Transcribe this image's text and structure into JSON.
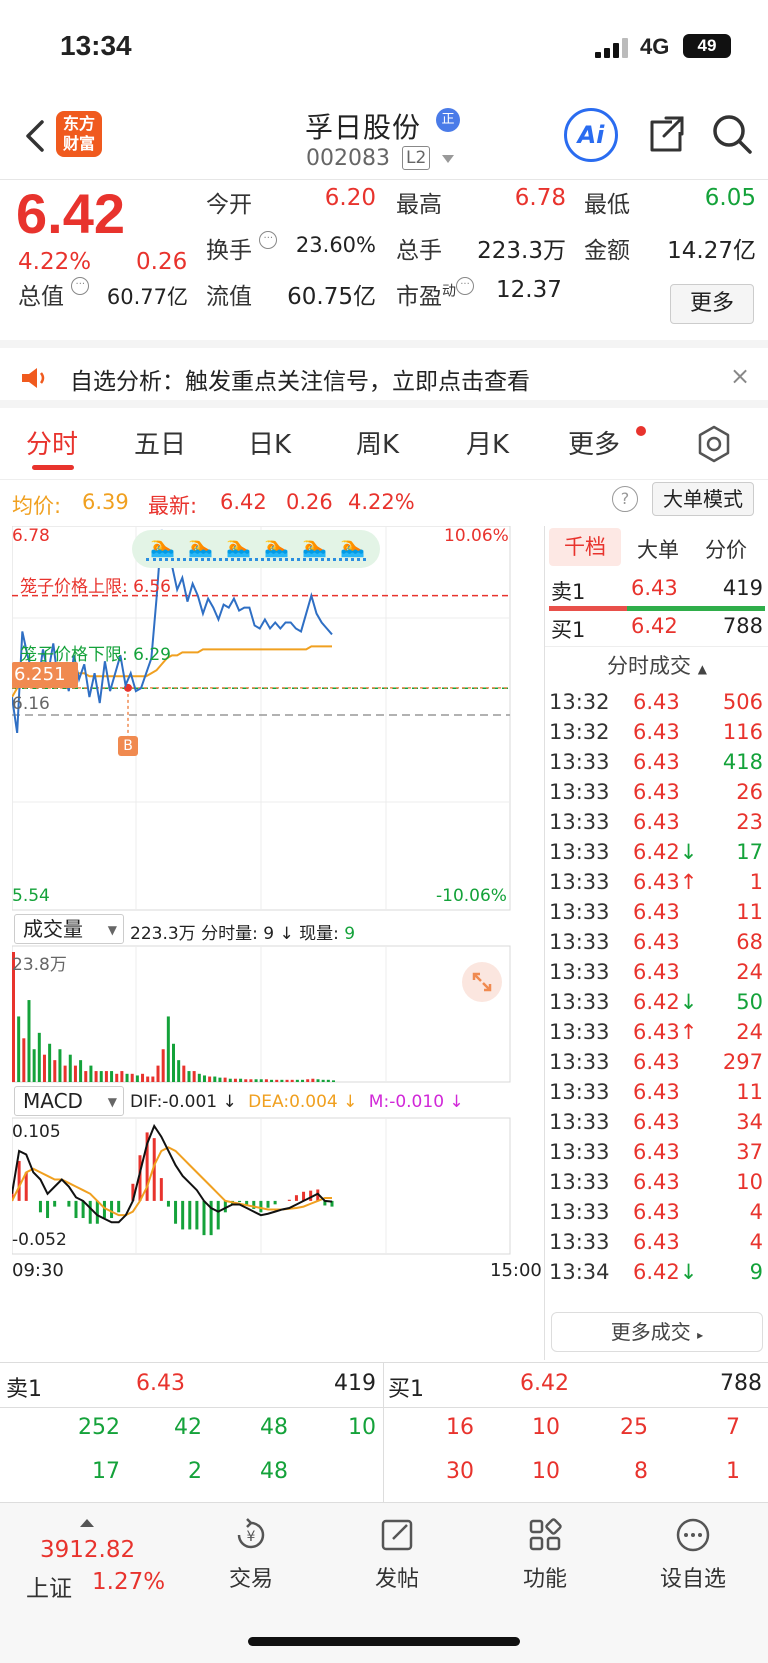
{
  "status_bar": {
    "time": "13:34",
    "network": "4G",
    "battery": "49"
  },
  "header": {
    "logo_line1": "东方",
    "logo_line2": "财富",
    "stock_name": "孚日股份",
    "badge": "正",
    "stock_code": "002083",
    "level_badge": "L2",
    "ai_label": "Ai"
  },
  "quote": {
    "last_price": "6.42",
    "change_pct": "4.22%",
    "change_abs": "0.26",
    "open_label": "今开",
    "open": "6.20",
    "high_label": "最高",
    "high": "6.78",
    "low_label": "最低",
    "low": "6.05",
    "turnover_label": "换手",
    "turnover": "23.60%",
    "volume_label": "总手",
    "volume": "223.3万",
    "amount_label": "金额",
    "amount": "14.27亿",
    "mktcap_label": "总值",
    "mktcap": "60.77亿",
    "float_label": "流值",
    "float_cap": "60.75亿",
    "pe_label": "市盈",
    "pe_sup": "动",
    "pe": "12.37",
    "more": "更多"
  },
  "banner": {
    "text": "自选分析：触发重点关注信号，立即点击查看",
    "close": "×"
  },
  "tabs": [
    {
      "label": "分时",
      "active": true
    },
    {
      "label": "五日"
    },
    {
      "label": "日K"
    },
    {
      "label": "周K"
    },
    {
      "label": "月K"
    },
    {
      "label": "更多"
    }
  ],
  "avg_row": {
    "avg_label": "均价:",
    "avg_value": "6.39",
    "latest_label": "最新:",
    "latest_value": "6.42",
    "chg_abs": "0.26",
    "chg_pct": "4.22%",
    "help": "?",
    "mode_button": "大单模式"
  },
  "chart_data": [
    {
      "type": "line",
      "title": "分时",
      "y_max_label": "6.78",
      "y_min_label": "5.54",
      "pct_max_label": "10.06%",
      "pct_min_label": "-10.06%",
      "ylim": [
        5.54,
        6.78
      ],
      "prev_close": "6.16",
      "cursor_price": "6.251",
      "upper_limit_label": "笼子价格上限:",
      "upper_limit": "6.56",
      "lower_limit_label": "笼子价格下限:",
      "lower_limit": "6.29",
      "buy_marker": "B",
      "x_start": "09:30",
      "x_end": "15:00",
      "series": [
        {
          "values": [
            6.22,
            6.1,
            6.44,
            6.36,
            6.3,
            6.26,
            6.38,
            6.3,
            6.4,
            6.26,
            6.32,
            6.24,
            6.36,
            6.28,
            6.33,
            6.22,
            6.3,
            6.2,
            6.34,
            6.24,
            6.3,
            6.36,
            6.26,
            6.3,
            6.24,
            6.25,
            6.3,
            6.35,
            6.55,
            6.78,
            6.72,
            6.66,
            6.58,
            6.62,
            6.54,
            6.6,
            6.56,
            6.5,
            6.55,
            6.52,
            6.48,
            6.53,
            6.52,
            6.55,
            6.51,
            6.52,
            6.52,
            6.46,
            6.45,
            6.48,
            6.45,
            6.47,
            6.45,
            6.47,
            6.47,
            6.45,
            6.44,
            6.5,
            6.56,
            6.5,
            6.47,
            6.45,
            6.43
          ]
        },
        {
          "values": [
            6.22,
            6.25,
            6.28,
            6.29,
            6.29,
            6.3,
            6.3,
            6.3,
            6.3,
            6.3,
            6.3,
            6.3,
            6.3,
            6.3,
            6.3,
            6.29,
            6.29,
            6.29,
            6.29,
            6.29,
            6.29,
            6.29,
            6.29,
            6.29,
            6.29,
            6.29,
            6.29,
            6.3,
            6.31,
            6.33,
            6.35,
            6.36,
            6.36,
            6.37,
            6.37,
            6.37,
            6.37,
            6.38,
            6.38,
            6.38,
            6.38,
            6.38,
            6.38,
            6.38,
            6.38,
            6.38,
            6.38,
            6.38,
            6.38,
            6.38,
            6.38,
            6.38,
            6.38,
            6.38,
            6.38,
            6.38,
            6.38,
            6.38,
            6.39,
            6.39,
            6.39,
            6.39,
            6.39
          ]
        }
      ]
    },
    {
      "type": "bar",
      "title": "成交量",
      "total": "223.3万",
      "minute_vol_label": "分时量:",
      "minute_vol": "9",
      "now_vol_label": "现量:",
      "now_vol": "9",
      "ymax_label": "23.8万",
      "values": [
        23.8,
        12,
        8,
        15,
        6,
        9,
        5,
        7,
        4,
        6,
        3,
        5,
        3,
        4,
        2,
        3,
        2,
        2,
        2,
        2,
        1.5,
        2,
        1.5,
        1.5,
        1.2,
        1.5,
        1,
        1,
        3,
        6,
        12,
        7,
        4,
        3,
        2,
        2,
        1.5,
        1.2,
        1,
        1,
        0.8,
        0.8,
        0.6,
        0.6,
        0.6,
        0.5,
        0.5,
        0.5,
        0.5,
        0.5,
        0.4,
        0.4,
        0.4,
        0.4,
        0.4,
        0.4,
        0.4,
        0.5,
        0.6,
        0.5,
        0.4,
        0.4,
        0.3
      ]
    },
    {
      "type": "line",
      "title": "MACD",
      "dif_label": "DIF:",
      "dif": "-0.001",
      "dea_label": "DEA:",
      "dea": "0.004",
      "m_label": "M:",
      "m": "-0.010",
      "ymax_label": "0.105",
      "ymin_label": "-0.052",
      "ylim": [
        -0.052,
        0.105
      ],
      "dif_values": [
        0.01,
        0.07,
        0.065,
        0.04,
        0.03,
        0.01,
        0.02,
        0.03,
        0.02,
        0.005,
        0.0,
        -0.01,
        -0.02,
        -0.025,
        -0.03,
        -0.03,
        -0.02,
        0.0,
        0.04,
        0.08,
        0.105,
        0.09,
        0.07,
        0.05,
        0.035,
        0.025,
        0.015,
        0.0,
        -0.01,
        -0.015,
        -0.01,
        -0.005,
        -0.005,
        -0.01,
        -0.015,
        -0.02,
        -0.018,
        -0.015,
        -0.012,
        -0.01,
        -0.005,
        0.0,
        0.005,
        0.01,
        0.0,
        -0.001
      ],
      "dea_values": [
        0.0,
        0.02,
        0.04,
        0.045,
        0.04,
        0.035,
        0.03,
        0.03,
        0.025,
        0.02,
        0.015,
        0.01,
        0.0,
        -0.01,
        -0.015,
        -0.02,
        -0.02,
        -0.015,
        0.0,
        0.02,
        0.05,
        0.07,
        0.075,
        0.07,
        0.06,
        0.05,
        0.04,
        0.03,
        0.02,
        0.01,
        0.0,
        -0.002,
        -0.004,
        -0.006,
        -0.008,
        -0.01,
        -0.012,
        -0.012,
        -0.012,
        -0.011,
        -0.01,
        -0.008,
        -0.004,
        0.0,
        0.004,
        0.004
      ],
      "macd_values": [
        0.02,
        0.07,
        0.05,
        0.0,
        -0.02,
        -0.03,
        -0.01,
        0.0,
        -0.01,
        -0.03,
        -0.03,
        -0.04,
        -0.04,
        -0.03,
        -0.03,
        -0.02,
        0.0,
        0.03,
        0.08,
        0.12,
        0.11,
        0.04,
        -0.01,
        -0.04,
        -0.05,
        -0.05,
        -0.05,
        -0.06,
        -0.06,
        -0.05,
        -0.02,
        -0.006,
        -0.002,
        -0.008,
        -0.014,
        -0.02,
        -0.012,
        -0.006,
        0.0,
        0.002,
        0.01,
        0.016,
        0.018,
        0.02,
        -0.008,
        -0.01
      ]
    }
  ],
  "right_panel": {
    "tabs": [
      "千档",
      "大单",
      "分价"
    ],
    "sell1": {
      "label": "卖1",
      "price": "6.43",
      "vol": "419"
    },
    "buy1": {
      "label": "买1",
      "price": "6.42",
      "vol": "788"
    },
    "ticks_header": "分时成交",
    "ticks": [
      {
        "time": "13:32",
        "price": "6.43",
        "arrow": "",
        "vol": "506",
        "color": "red"
      },
      {
        "time": "13:32",
        "price": "6.43",
        "arrow": "",
        "vol": "116",
        "color": "red"
      },
      {
        "time": "13:33",
        "price": "6.43",
        "arrow": "",
        "vol": "418",
        "color": "green"
      },
      {
        "time": "13:33",
        "price": "6.43",
        "arrow": "",
        "vol": "26",
        "color": "red"
      },
      {
        "time": "13:33",
        "price": "6.43",
        "arrow": "",
        "vol": "23",
        "color": "red"
      },
      {
        "time": "13:33",
        "price": "6.42",
        "arrow": "↓",
        "vol": "17",
        "color": "green"
      },
      {
        "time": "13:33",
        "price": "6.43",
        "arrow": "↑",
        "vol": "1",
        "color": "red"
      },
      {
        "time": "13:33",
        "price": "6.43",
        "arrow": "",
        "vol": "11",
        "color": "red"
      },
      {
        "time": "13:33",
        "price": "6.43",
        "arrow": "",
        "vol": "68",
        "color": "red"
      },
      {
        "time": "13:33",
        "price": "6.43",
        "arrow": "",
        "vol": "24",
        "color": "red"
      },
      {
        "time": "13:33",
        "price": "6.42",
        "arrow": "↓",
        "vol": "50",
        "color": "green"
      },
      {
        "time": "13:33",
        "price": "6.43",
        "arrow": "↑",
        "vol": "24",
        "color": "red"
      },
      {
        "time": "13:33",
        "price": "6.43",
        "arrow": "",
        "vol": "297",
        "color": "red"
      },
      {
        "time": "13:33",
        "price": "6.43",
        "arrow": "",
        "vol": "11",
        "color": "red"
      },
      {
        "time": "13:33",
        "price": "6.43",
        "arrow": "",
        "vol": "34",
        "color": "red"
      },
      {
        "time": "13:33",
        "price": "6.43",
        "arrow": "",
        "vol": "37",
        "color": "red"
      },
      {
        "time": "13:33",
        "price": "6.43",
        "arrow": "",
        "vol": "10",
        "color": "red"
      },
      {
        "time": "13:33",
        "price": "6.43",
        "arrow": "",
        "vol": "4",
        "color": "red"
      },
      {
        "time": "13:33",
        "price": "6.43",
        "arrow": "",
        "vol": "4",
        "color": "red"
      },
      {
        "time": "13:34",
        "price": "6.42",
        "arrow": "↓",
        "vol": "9",
        "color": "green"
      }
    ],
    "more_ticks": "更多成交"
  },
  "book": {
    "sell1_label": "卖1",
    "sell1_price": "6.43",
    "sell1_vol": "419",
    "buy1_label": "买1",
    "buy1_price": "6.42",
    "buy1_vol": "788",
    "sell_queue": [
      [
        "252",
        "42",
        "48",
        "10"
      ],
      [
        "17",
        "2",
        "48",
        ""
      ]
    ],
    "buy_queue": [
      [
        "16",
        "10",
        "25",
        "7"
      ],
      [
        "30",
        "10",
        "8",
        "1"
      ]
    ]
  },
  "bottom_nav": {
    "index_value": "3912.82",
    "index_name": "上证",
    "index_change": "1.27%",
    "items": [
      "交易",
      "发帖",
      "功能",
      "设自选"
    ]
  },
  "colors": {
    "up": "#e8332d",
    "down": "#14a23a",
    "avg": "#f0a020",
    "price_line": "#2f6fc4",
    "accent": "#f05a1e"
  }
}
